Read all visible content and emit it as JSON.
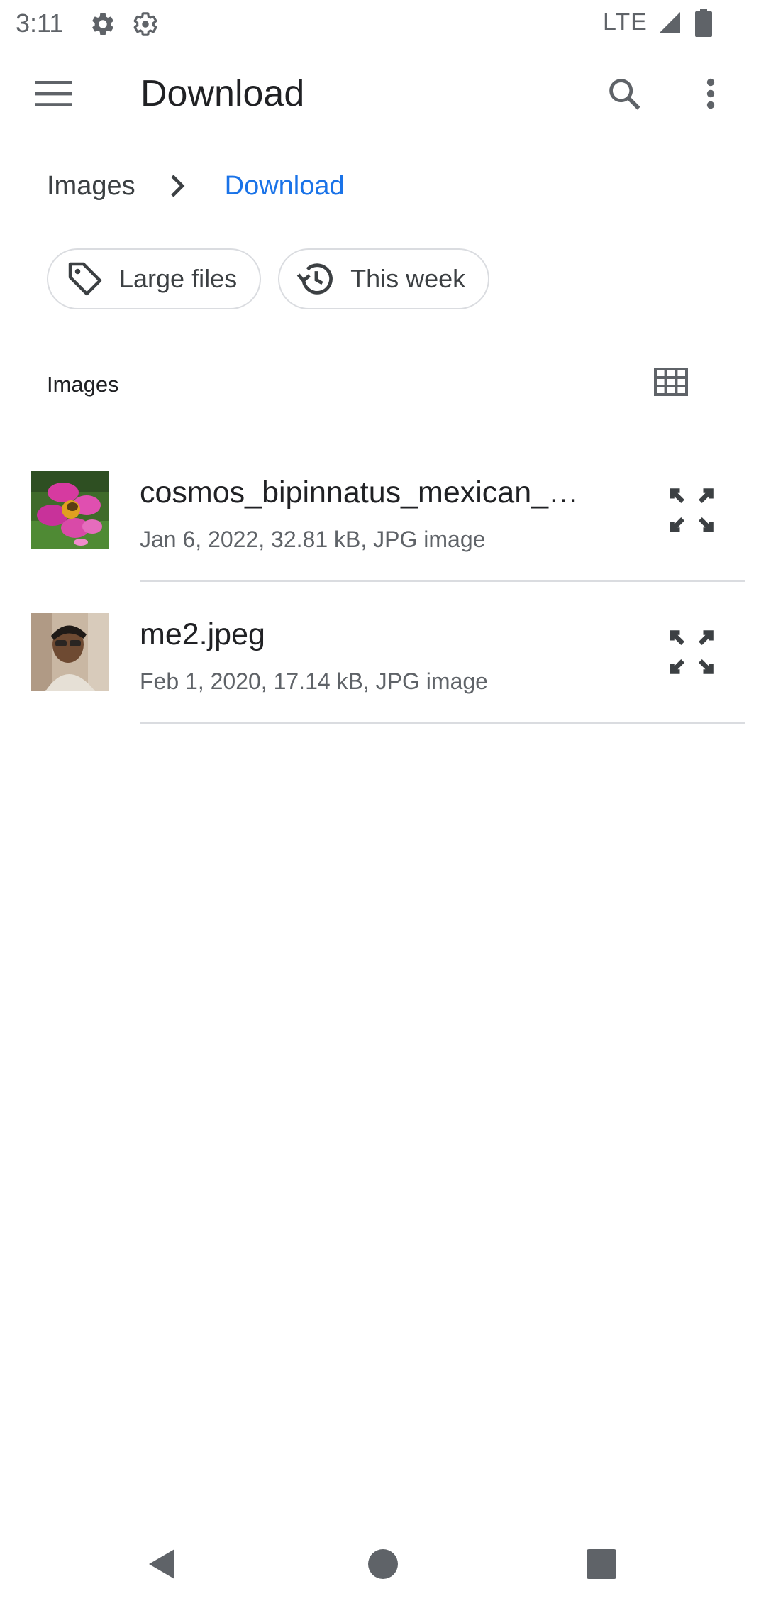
{
  "status_bar": {
    "time": "3:11",
    "network": "LTE",
    "icons": [
      "settings-icon",
      "settings-outline-icon",
      "signal-icon",
      "battery-icon"
    ]
  },
  "app_bar": {
    "title": "Download",
    "icons": [
      "menu-icon",
      "search-icon",
      "more-vert-icon"
    ]
  },
  "breadcrumb": {
    "items": [
      "Images",
      "Download"
    ],
    "active_color": "#1a73e8"
  },
  "chips": [
    {
      "label": "Large files",
      "icon": "tag-icon"
    },
    {
      "label": "This week",
      "icon": "history-icon"
    }
  ],
  "section": {
    "label": "Images",
    "view_toggle_icon": "grid-view-icon"
  },
  "files": [
    {
      "name": "cosmos_bipinnatus_mexican_…",
      "meta": "Jan 6, 2022, 32.81 kB, JPG image",
      "thumbnail": "flower-photo"
    },
    {
      "name": "me2.jpeg",
      "meta": "Feb 1, 2020, 17.14 kB, JPG image",
      "thumbnail": "person-photo"
    }
  ],
  "nav_bar": {
    "icons": [
      "back-icon",
      "home-icon",
      "recents-icon"
    ]
  }
}
